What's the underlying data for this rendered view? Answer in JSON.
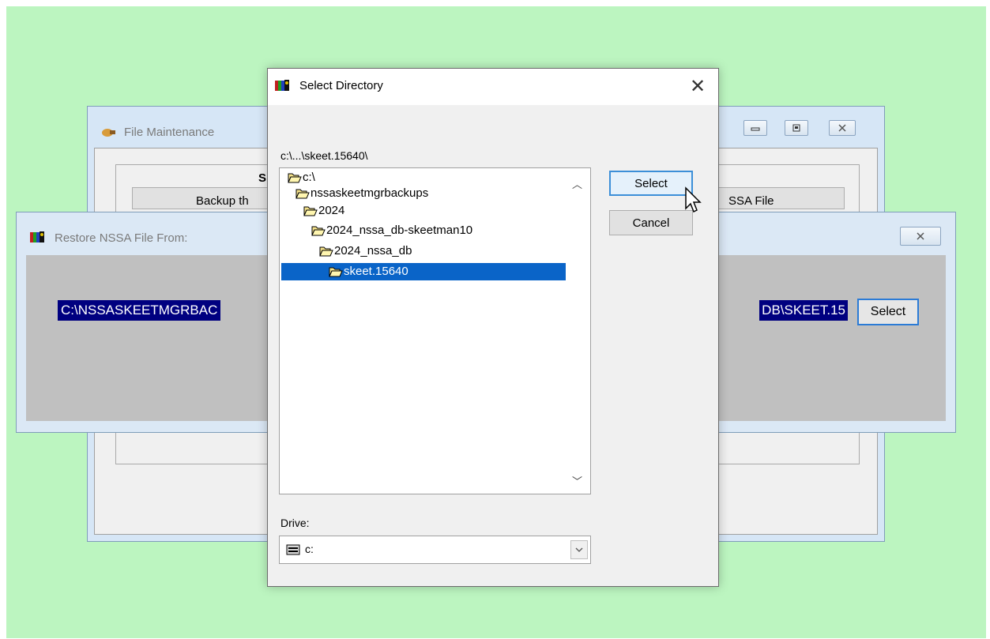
{
  "file_maintenance": {
    "title": "File Maintenance",
    "group_label": "Sh",
    "button_left_label": "Backup th",
    "button_right_label": "SSA File"
  },
  "restore_window": {
    "title": "Restore NSSA File From:",
    "path_start": "C:\\NSSASKEETMGRBAC",
    "path_end": "DB\\SKEET.15",
    "select_label": "Select"
  },
  "select_directory": {
    "title": "Select Directory",
    "current_path": "c:\\...\\skeet.15640\\",
    "tree": [
      {
        "label": "c:\\",
        "icon": "open-folder-icon"
      },
      {
        "label": "nssaskeetmgrbackups",
        "icon": "open-folder-icon"
      },
      {
        "label": "2024",
        "icon": "open-folder-icon"
      },
      {
        "label": "2024_nssa_db-skeetman10",
        "icon": "open-folder-icon"
      },
      {
        "label": "2024_nssa_db",
        "icon": "open-folder-icon"
      },
      {
        "label": "skeet.15640",
        "icon": "open-folder-icon",
        "selected": true
      }
    ],
    "select_button": "Select",
    "cancel_button": "Cancel",
    "drive_label": "Drive:",
    "drive_value": "c:"
  },
  "colors": {
    "desktop": "#bcf5c0",
    "selection": "#0a64c8",
    "path_highlight": "#000080"
  }
}
